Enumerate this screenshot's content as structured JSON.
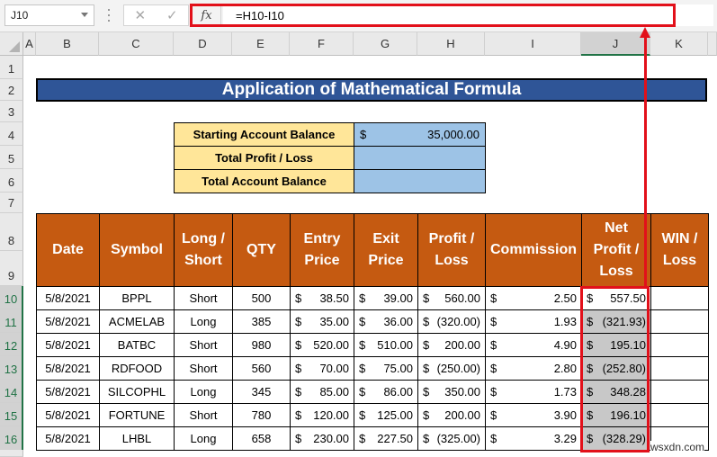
{
  "formula_bar": {
    "name_box": "J10",
    "cancel_icon": "✕",
    "enter_icon": "✓",
    "fx_label": "fx",
    "formula": "=H10-I10"
  },
  "columns": [
    "A",
    "B",
    "C",
    "D",
    "E",
    "F",
    "G",
    "H",
    "I",
    "J",
    "K"
  ],
  "selected_column": "J",
  "rows": [
    "1",
    "2",
    "3",
    "4",
    "5",
    "6",
    "7",
    "8",
    "9",
    "10",
    "11",
    "12",
    "13",
    "14",
    "15",
    "16"
  ],
  "title": "Application of Mathematical Formula",
  "summary": [
    {
      "label": "Starting Account Balance",
      "currency": "$",
      "value": "35,000.00"
    },
    {
      "label": "Total Profit / Loss",
      "currency": "",
      "value": ""
    },
    {
      "label": "Total Account Balance",
      "currency": "",
      "value": ""
    }
  ],
  "table": {
    "headers": [
      "Date",
      "Symbol",
      "Long / Short",
      "QTY",
      "Entry Price",
      "Exit Price",
      "Profit / Loss",
      "Commission",
      "Net Profit / Loss",
      "WIN / Loss"
    ],
    "rows": [
      {
        "date": "5/8/2021",
        "symbol": "BPPL",
        "side": "Short",
        "qty": "500",
        "entry": "38.50",
        "exit": "39.00",
        "pl": "560.00",
        "commission": "2.50",
        "net": "557.50",
        "win": ""
      },
      {
        "date": "5/8/2021",
        "symbol": "ACMELAB",
        "side": "Long",
        "qty": "385",
        "entry": "35.00",
        "exit": "36.00",
        "pl": "(320.00)",
        "commission": "1.93",
        "net": "(321.93)",
        "win": ""
      },
      {
        "date": "5/8/2021",
        "symbol": "BATBC",
        "side": "Short",
        "qty": "980",
        "entry": "520.00",
        "exit": "510.00",
        "pl": "200.00",
        "commission": "4.90",
        "net": "195.10",
        "win": ""
      },
      {
        "date": "5/8/2021",
        "symbol": "RDFOOD",
        "side": "Short",
        "qty": "560",
        "entry": "70.00",
        "exit": "75.00",
        "pl": "(250.00)",
        "commission": "2.80",
        "net": "(252.80)",
        "win": ""
      },
      {
        "date": "5/8/2021",
        "symbol": "SILCOPHL",
        "side": "Long",
        "qty": "345",
        "entry": "85.00",
        "exit": "86.00",
        "pl": "350.00",
        "commission": "1.73",
        "net": "348.28",
        "win": ""
      },
      {
        "date": "5/8/2021",
        "symbol": "FORTUNE",
        "side": "Short",
        "qty": "780",
        "entry": "120.00",
        "exit": "125.00",
        "pl": "200.00",
        "commission": "3.90",
        "net": "196.10",
        "win": ""
      },
      {
        "date": "5/8/2021",
        "symbol": "LHBL",
        "side": "Long",
        "qty": "658",
        "entry": "230.00",
        "exit": "227.50",
        "pl": "(325.00)",
        "commission": "3.29",
        "net": "(328.29)",
        "win": ""
      }
    ],
    "currency_symbol": "$"
  },
  "watermark": "wsxdn.com",
  "colors": {
    "banner": "#2f5597",
    "header_fill": "#c55a11",
    "summary_label": "#ffe699",
    "summary_value": "#9dc3e6",
    "highlight": "#e2101a",
    "selection_fill": "#c8c8c8"
  }
}
